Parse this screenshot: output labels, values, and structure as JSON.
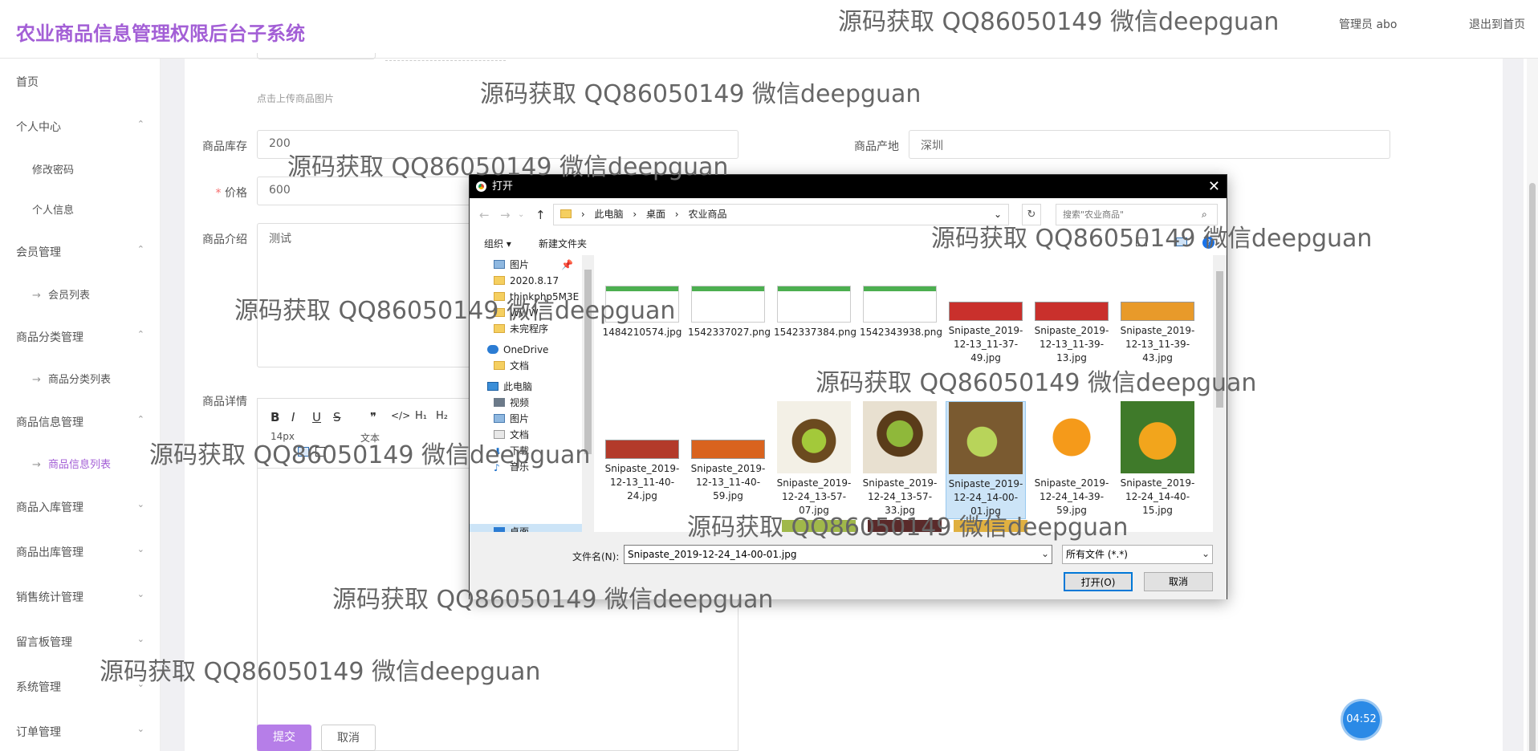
{
  "app": {
    "title": "农业商品信息管理权限后台子系统",
    "user": "管理员 abo",
    "logout": "退出到首页"
  },
  "sidebar": {
    "items": [
      {
        "label": "首页",
        "chev": ""
      },
      {
        "label": "个人中心",
        "chev": "⌃"
      },
      {
        "label": "修改密码",
        "sub": true
      },
      {
        "label": "个人信息",
        "sub": true
      },
      {
        "label": "会员管理",
        "chev": "⌃"
      },
      {
        "label": "会员列表",
        "sub": true,
        "arrow": "→"
      },
      {
        "label": "商品分类管理",
        "chev": "⌃"
      },
      {
        "label": "商品分类列表",
        "sub": true,
        "arrow": "→"
      },
      {
        "label": "商品信息管理",
        "chev": "⌃"
      },
      {
        "label": "商品信息列表",
        "sub": true,
        "arrow": "→",
        "active": true
      },
      {
        "label": "商品入库管理",
        "chev": "⌄"
      },
      {
        "label": "商品出库管理",
        "chev": "⌄"
      },
      {
        "label": "销售统计管理",
        "chev": "⌄"
      },
      {
        "label": "留言板管理",
        "chev": "⌄"
      },
      {
        "label": "系统管理",
        "chev": "⌄"
      },
      {
        "label": "订单管理",
        "chev": "⌄"
      }
    ]
  },
  "form": {
    "upload_hint": "点击上传商品图片",
    "stock_label": "商品库存",
    "stock_value": "200",
    "origin_label": "商品产地",
    "origin_value": "深圳",
    "price_label": "价格",
    "price_value": "600",
    "intro_label": "商品介绍",
    "intro_value": "测试",
    "detail_label": "商品详情",
    "editor_tools": [
      "B",
      "I",
      "U",
      "S",
      "❞",
      "</>",
      "H₁",
      "H₂"
    ],
    "font_size": "14px",
    "text_style": "文本",
    "submit": "提交",
    "cancel": "取消"
  },
  "timer": "04:52",
  "dialog": {
    "title": "打开",
    "path": [
      "此电脑",
      "桌面",
      "农业商品"
    ],
    "search_placeholder": "搜索\"农业商品\"",
    "organize": "组织 ▾",
    "new_folder": "新建文件夹",
    "tree": [
      {
        "label": "图片",
        "icon": "pictures"
      },
      {
        "label": "2020.8.17",
        "icon": "folder"
      },
      {
        "label": "thinkphp5M3E",
        "icon": "folder"
      },
      {
        "label": "WWW",
        "icon": "folder"
      },
      {
        "label": "未完程序",
        "icon": "folder"
      },
      {
        "label": "OneDrive",
        "icon": "cloud"
      },
      {
        "label": "文档",
        "icon": "folder"
      },
      {
        "label": "此电脑",
        "icon": "pc"
      },
      {
        "label": "视频",
        "icon": "video"
      },
      {
        "label": "图片",
        "icon": "pictures"
      },
      {
        "label": "文档",
        "icon": "doc"
      },
      {
        "label": "下载",
        "icon": "download"
      },
      {
        "label": "音乐",
        "icon": "music"
      },
      {
        "label": "桌面",
        "icon": "desktop"
      }
    ],
    "files_row1": [
      "1484210574.jpg",
      "1542337027.png",
      "1542337384.png",
      "1542343938.png",
      "Snipaste_2019-12-13_11-37-49.jpg",
      "Snipaste_2019-12-13_11-39-13.jpg",
      "Snipaste_2019-12-13_11-39-43.jpg"
    ],
    "files_row2": [
      "Snipaste_2019-12-13_11-40-24.jpg",
      "Snipaste_2019-12-13_11-40-59.jpg",
      "Snipaste_2019-12-24_13-57-07.jpg",
      "Snipaste_2019-12-24_13-57-33.jpg",
      "Snipaste_2019-12-24_14-00-01.jpg",
      "Snipaste_2019-12-24_14-39-59.jpg",
      "Snipaste_2019-12-24_14-40-15.jpg"
    ],
    "filename_label": "文件名(N):",
    "filename_value": "Snipaste_2019-12-24_14-00-01.jpg",
    "filetype": "所有文件 (*.*)",
    "open": "打开(O)",
    "cancel": "取消"
  },
  "watermark": "源码获取 QQ86050149 微信deepguan"
}
